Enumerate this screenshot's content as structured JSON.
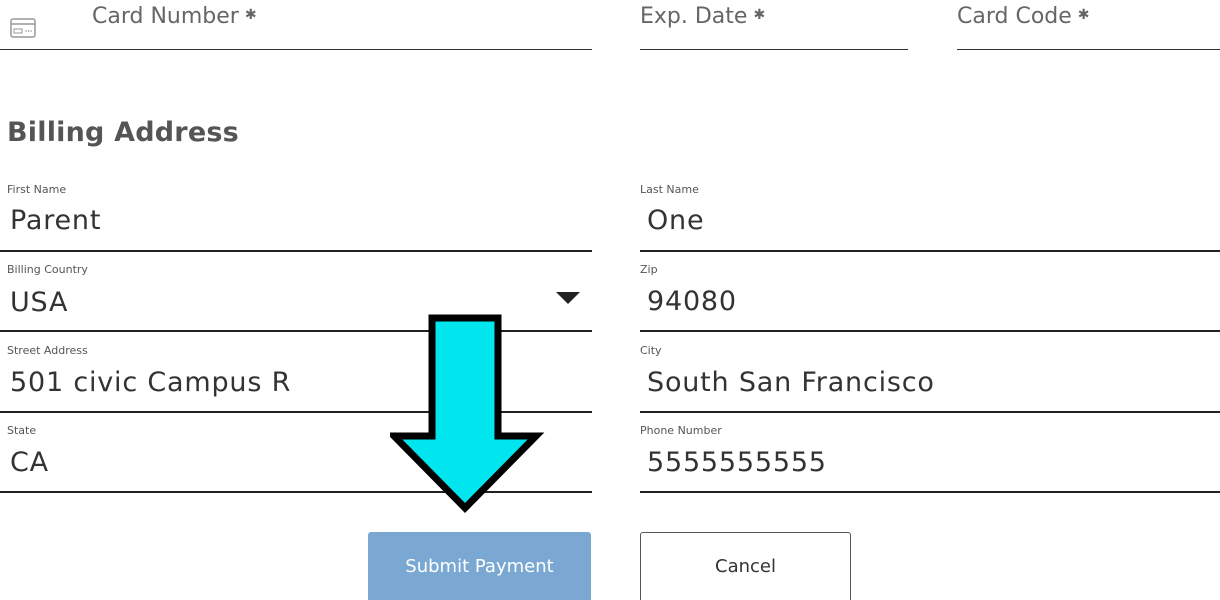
{
  "card": {
    "number_placeholder": "Card Number",
    "exp_placeholder": "Exp. Date",
    "code_placeholder": "Card Code",
    "required_mark": "✱"
  },
  "billing": {
    "title": "Billing Address",
    "first_name": {
      "label": "First Name",
      "value": "Parent"
    },
    "last_name": {
      "label": "Last Name",
      "value": "One"
    },
    "country": {
      "label": "Billing Country",
      "value": "USA"
    },
    "zip": {
      "label": "Zip",
      "value": "94080"
    },
    "street": {
      "label": "Street Address",
      "value": "501 civic Campus R"
    },
    "city": {
      "label": "City",
      "value": "South San Francisco"
    },
    "state": {
      "label": "State",
      "value": "CA"
    },
    "phone": {
      "label": "Phone Number",
      "value": "5555555555"
    }
  },
  "actions": {
    "submit_label": "Submit Payment",
    "cancel_label": "Cancel"
  },
  "colors": {
    "submit_bg": "#7ba8d3",
    "arrow_fill": "#00e5ee",
    "arrow_stroke": "#000000"
  },
  "icons": {
    "card": "credit-card-icon",
    "dropdown": "caret-down-icon",
    "annotation": "arrow-down-icon"
  }
}
